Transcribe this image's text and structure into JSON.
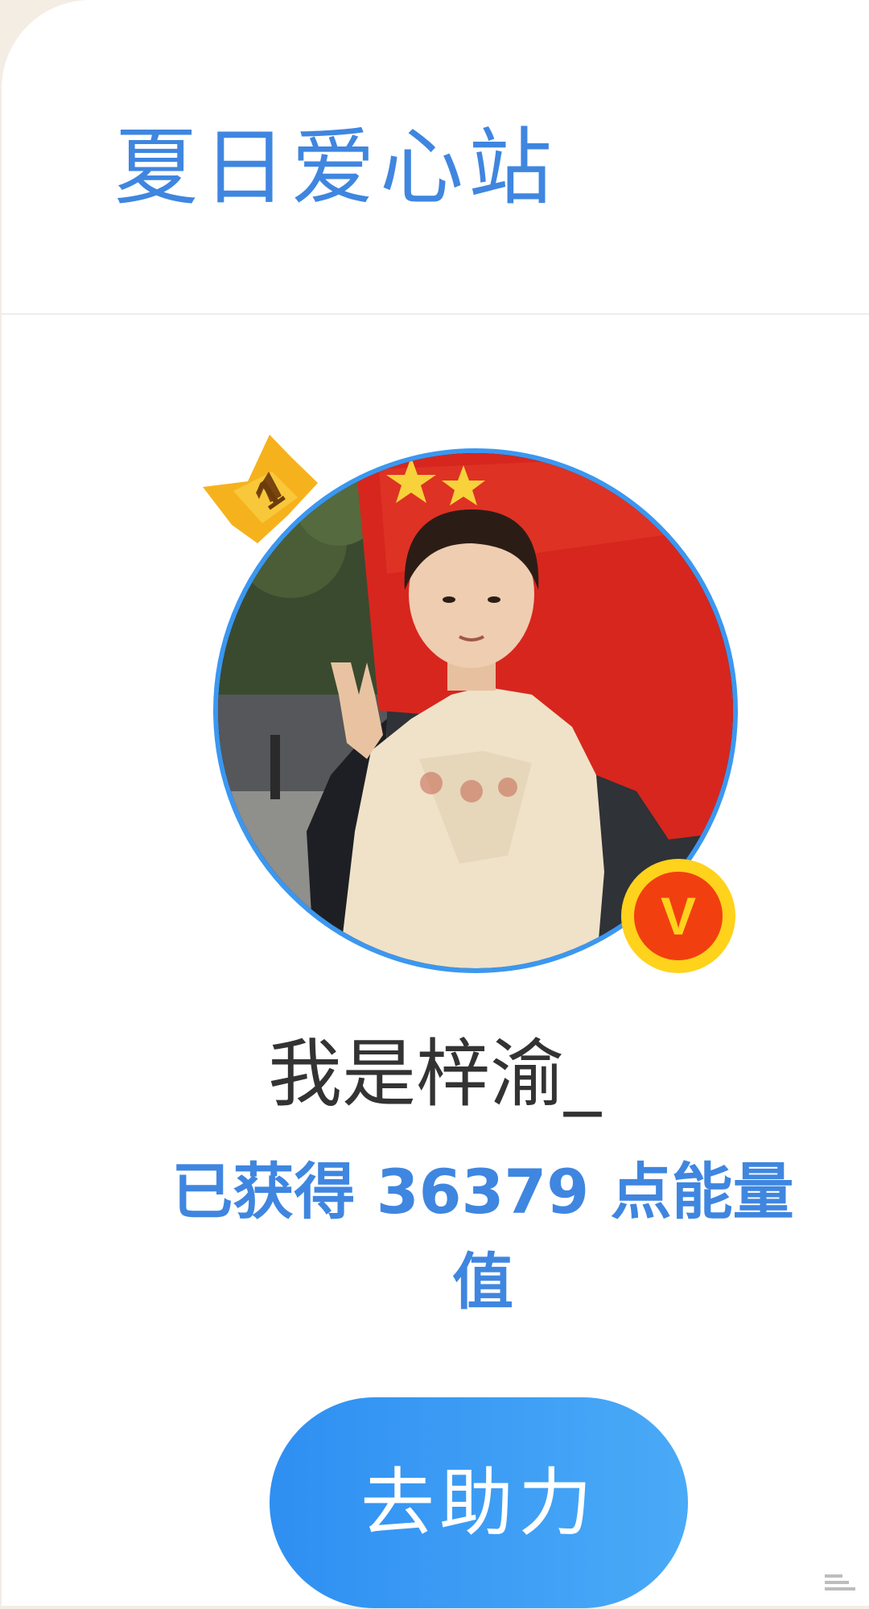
{
  "page": {
    "title": "夏日爱心站"
  },
  "profile": {
    "rank": "1",
    "username": "我是梓渝_",
    "energy_text": "已获得 36379 点能量值",
    "verified_mark": "V",
    "avatar_icon": "avatar-photo"
  },
  "actions": {
    "help_label": "去助力"
  },
  "colors": {
    "accent": "#3f86e0",
    "button": "#3b97f0",
    "crown": "#f6b21d",
    "verify": "#f23f10",
    "verify_ring": "#ffd21c"
  }
}
